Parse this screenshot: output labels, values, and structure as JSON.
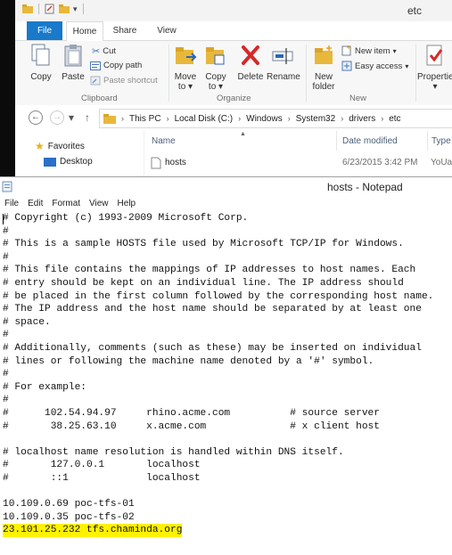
{
  "explorer": {
    "title": "etc",
    "tabs": [
      "File",
      "Home",
      "Share",
      "View"
    ],
    "ribbon": {
      "copy": "Copy",
      "paste": "Paste",
      "cut": "Cut",
      "copy_path": "Copy path",
      "paste_shortcut": "Paste shortcut",
      "move_to": "Move",
      "move_to_2": "to",
      "copy_to": "Copy",
      "copy_to_2": "to",
      "delete": "Delete",
      "rename": "Rename",
      "new_folder": "New",
      "new_folder_2": "folder",
      "new_item": "New item",
      "easy_access": "Easy access",
      "properties": "Propertie",
      "groups": {
        "clipboard": "Clipboard",
        "organize": "Organize",
        "new": "New"
      }
    },
    "breadcrumb": [
      "This PC",
      "Local Disk (C:)",
      "Windows",
      "System32",
      "drivers",
      "etc"
    ],
    "nav": {
      "favorites": "Favorites",
      "desktop": "Desktop"
    },
    "columns": {
      "name": "Name",
      "date": "Date modified",
      "type": "Type"
    },
    "file": {
      "name": "hosts",
      "date": "6/23/2015 3:42 PM",
      "type": "YoUa"
    }
  },
  "notepad": {
    "title": "hosts - Notepad",
    "menu": [
      "File",
      "Edit",
      "Format",
      "View",
      "Help"
    ],
    "lines": [
      "# Copyright (c) 1993-2009 Microsoft Corp.",
      "#",
      "# This is a sample HOSTS file used by Microsoft TCP/IP for Windows.",
      "#",
      "# This file contains the mappings of IP addresses to host names. Each",
      "# entry should be kept on an individual line. The IP address should",
      "# be placed in the first column followed by the corresponding host name.",
      "# The IP address and the host name should be separated by at least one",
      "# space.",
      "#",
      "# Additionally, comments (such as these) may be inserted on individual",
      "# lines or following the machine name denoted by a '#' symbol.",
      "#",
      "# For example:",
      "#",
      "#      102.54.94.97     rhino.acme.com          # source server",
      "#       38.25.63.10     x.acme.com              # x client host",
      "",
      "# localhost name resolution is handled within DNS itself.",
      "#       127.0.0.1       localhost",
      "#       ::1             localhost",
      "",
      "10.109.0.69 poc-tfs-01",
      "10.109.0.35 poc-tfs-02",
      "23.101.25.232 tfs.chaminda.org"
    ]
  }
}
